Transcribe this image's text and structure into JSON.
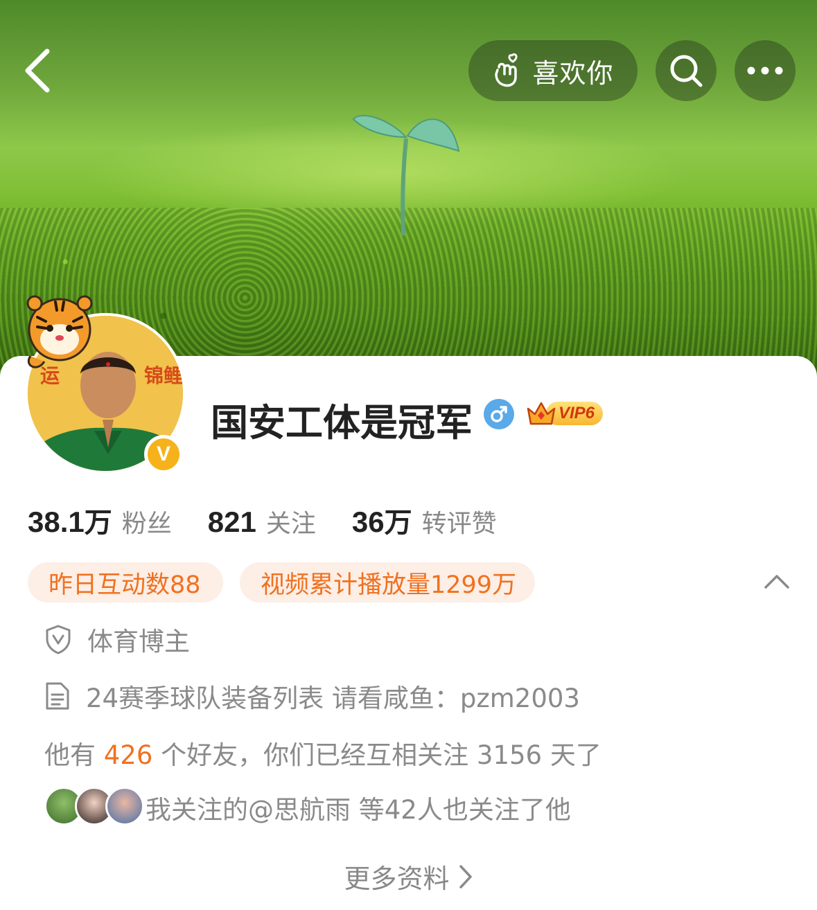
{
  "header": {
    "like_label": "喜欢你"
  },
  "profile": {
    "name": "国安工体是冠军",
    "verified_badge": "V",
    "gender": "♂",
    "vip_label": "VIP6"
  },
  "stats": [
    {
      "num": "38.1",
      "unit": "万",
      "label": "粉丝"
    },
    {
      "num": "821",
      "unit": "",
      "label": "关注"
    },
    {
      "num": "36",
      "unit": "万",
      "label": "转评赞"
    }
  ],
  "tags": [
    "昨日互动数88",
    "视频累计播放量1299万"
  ],
  "info": {
    "category": "体育博主",
    "description": "24赛季球队装备列表 请看咸鱼：pzm2003"
  },
  "friends": {
    "prefix": "他有",
    "count": "426",
    "suffix": "个好友，你们已经互相关注 3156 天了"
  },
  "mutual": {
    "text": "我关注的@思航雨 等42人也关注了他"
  },
  "more_info_label": "更多资料",
  "icons": {
    "back": "back-arrow-icon",
    "like": "finger-heart-icon",
    "search": "search-icon",
    "more": "more-dots-icon",
    "category": "shield-v-icon",
    "description": "document-icon",
    "collapse": "chevron-up-icon",
    "more_info": "chevron-right-icon"
  },
  "colors": {
    "accent_orange": "#f0711f",
    "tag_bg": "#fdeee6",
    "gender_blue": "#5aa9e8",
    "verified_gold": "#f5b21a"
  }
}
